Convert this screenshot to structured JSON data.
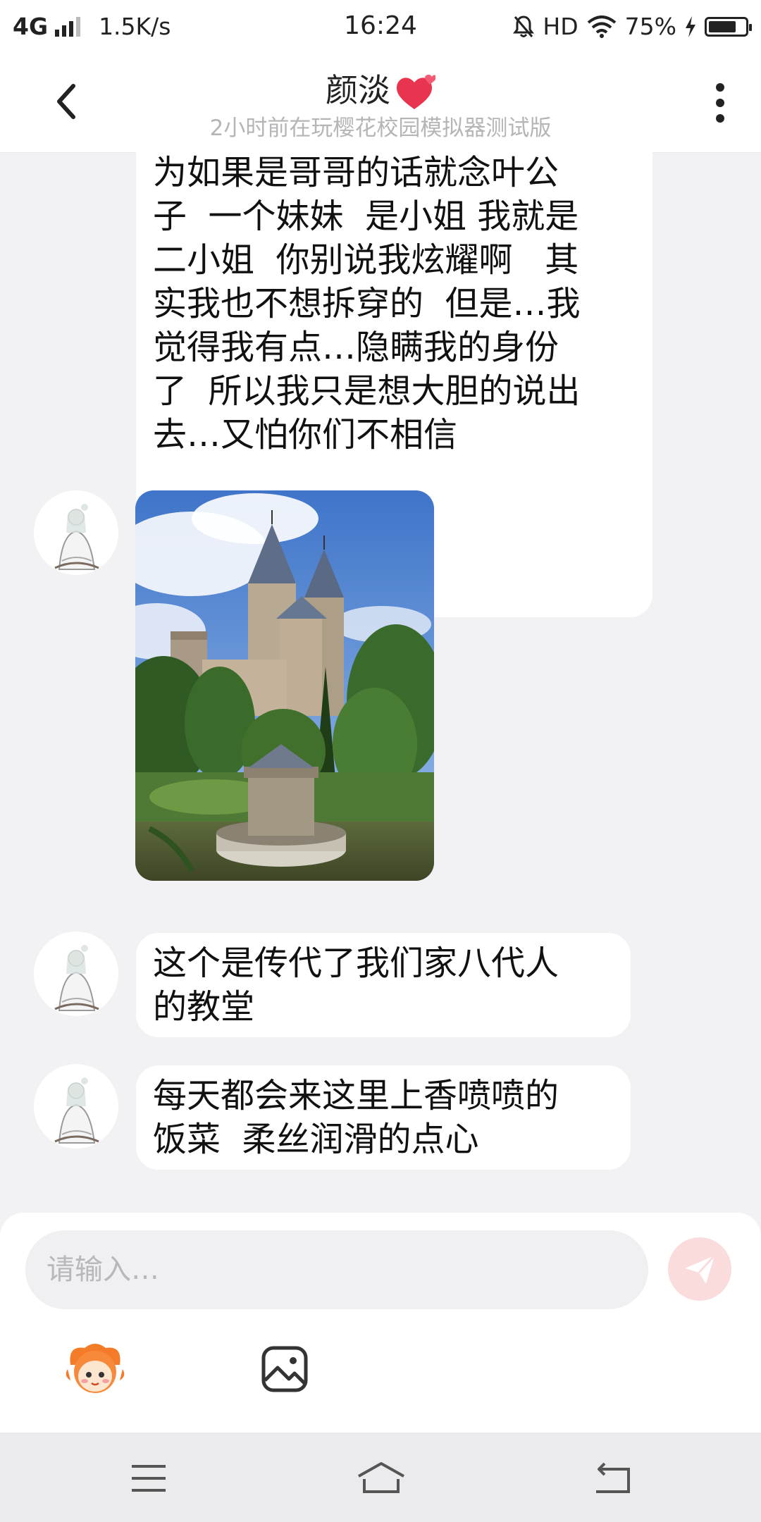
{
  "status_bar": {
    "network": "4G",
    "speed": "1.5K/s",
    "time": "16:24",
    "hd": "HD",
    "battery": "75%",
    "battery_level": 0.75
  },
  "header": {
    "title": "颜淡",
    "subtitle": "2小时前在玩樱花校园模拟器测试版",
    "icons": [
      "back-arrow-icon",
      "heart-icon",
      "more-vert-icon"
    ]
  },
  "messages": [
    {
      "type": "text",
      "text": "为如果是哥哥的话就念叶公\n子  一个妹妹  是小姐 我就是\n二小姐  你别说我炫耀啊   其\n实我也不想拆穿的  但是…我\n觉得我有点…隐瞒我的身份\n了  所以我只是想大胆的说出\n去…又怕你们不相信"
    },
    {
      "type": "image",
      "icon": "castle-photo"
    },
    {
      "type": "text",
      "text": "这个是传代了我们家八代人\n的教堂"
    },
    {
      "type": "text",
      "text": "每天都会来这里上香喷喷的\n饭菜  柔丝润滑的点心"
    }
  ],
  "input": {
    "placeholder": "请输入…",
    "send_icon": "send-icon",
    "emoji_icon": "mascot-emoji-icon",
    "image_icon": "image-icon"
  },
  "colors": {
    "background": "#f2f2f5",
    "bubble": "#ffffff",
    "send_button": "#fbdcdc",
    "heart": "#e8344f"
  }
}
